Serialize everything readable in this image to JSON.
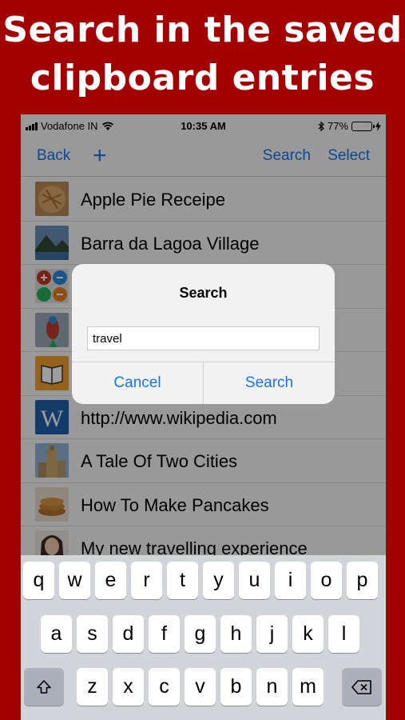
{
  "headline": {
    "line1": "Search in the saved",
    "line2": "clipboard entries"
  },
  "status_bar": {
    "carrier": "Vodafone IN",
    "time": "10:35 AM",
    "battery": "77%",
    "battery_level": 0.77,
    "icons": [
      "signal-bars-icon",
      "wifi-icon",
      "bluetooth-icon",
      "battery-icon",
      "charging-bolt-icon"
    ]
  },
  "nav": {
    "back": "Back",
    "add": "+",
    "search": "Search",
    "select": "Select"
  },
  "list": {
    "items": [
      {
        "label": "Apple Pie Receipe",
        "thumb": "apple-pie-thumbnail"
      },
      {
        "label": "Barra da Lagoa Village",
        "thumb": "village-thumbnail"
      },
      {
        "label": "",
        "thumb": "calculator-thumbnail"
      },
      {
        "label": "",
        "thumb": "parrot-thumbnail"
      },
      {
        "label": "",
        "thumb": "book-thumbnail"
      },
      {
        "label": "http://www.wikipedia.com",
        "thumb": "wikipedia-thumbnail"
      },
      {
        "label": "A Tale Of Two Cities",
        "thumb": "building-thumbnail"
      },
      {
        "label": "How To Make Pancakes",
        "thumb": "pancakes-thumbnail"
      },
      {
        "label": "My new travelling experience",
        "thumb": "portrait-thumbnail"
      }
    ]
  },
  "alert": {
    "title": "Search",
    "input_value": "travel",
    "cancel": "Cancel",
    "confirm": "Search"
  },
  "keyboard": {
    "row1": [
      "q",
      "w",
      "e",
      "r",
      "t",
      "y",
      "u",
      "i",
      "o",
      "p"
    ],
    "row2": [
      "a",
      "s",
      "d",
      "f",
      "g",
      "h",
      "j",
      "k",
      "l"
    ],
    "row3": [
      "z",
      "x",
      "c",
      "v",
      "b",
      "n",
      "m"
    ],
    "shift_icon": "shift-icon",
    "delete_icon": "backspace-icon"
  },
  "colors": {
    "background": "#a30000",
    "accent": "#1a73e8",
    "battery": "#2bd44a"
  }
}
